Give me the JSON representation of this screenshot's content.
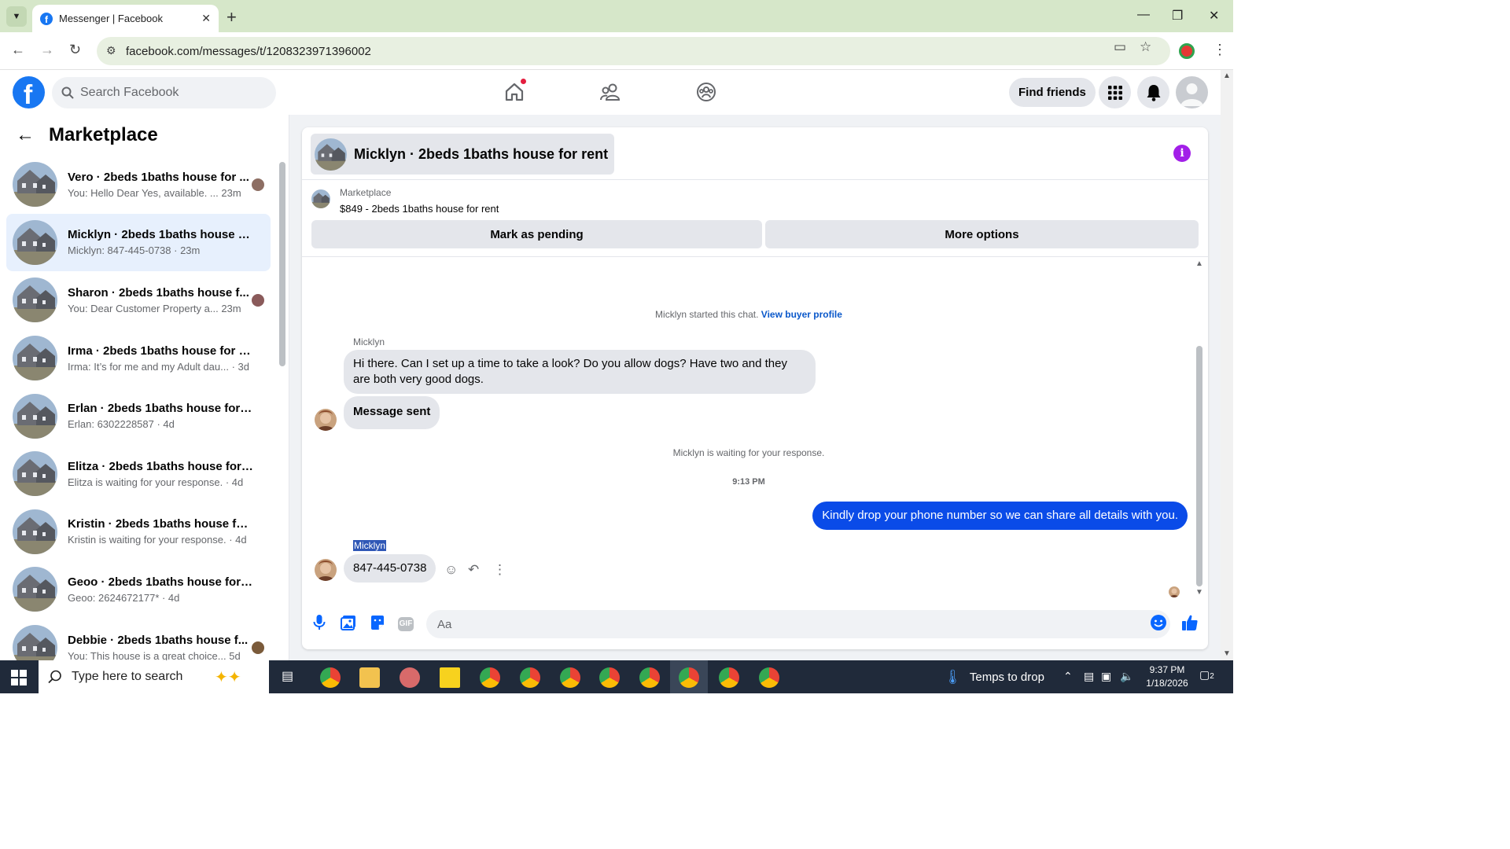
{
  "browser": {
    "tab_title": "Messenger | Facebook",
    "url": "facebook.com/messages/t/1208323971396002"
  },
  "fb_header": {
    "logo": "f",
    "search_placeholder": "Search Facebook",
    "find_friends_label": "Find friends"
  },
  "left_panel": {
    "title": "Marketplace",
    "conversations": [
      {
        "name": "Vero · 2beds 1baths house for ...",
        "preview": "You: Hello Dear Yes, available. ...  23m",
        "has_seen_avatar": true
      },
      {
        "name": "Micklyn · 2beds 1baths house fo...",
        "preview": "Micklyn: 847-445-0738 · 23m",
        "active": true
      },
      {
        "name": "Sharon · 2beds 1baths house f...",
        "preview": "You: Dear Customer Property a...  23m",
        "has_seen_avatar": true
      },
      {
        "name": "Irma · 2beds 1baths house for rent",
        "preview": "Irma: It’s for me and my Adult dau...  · 3d"
      },
      {
        "name": "Erlan · 2beds 1baths house for re...",
        "preview": "Erlan: 6302228587 · 4d"
      },
      {
        "name": "Elitza · 2beds 1baths house for r...",
        "preview": "Elitza is waiting for your response. · 4d"
      },
      {
        "name": "Kristin · 2beds 1baths house for ...",
        "preview": "Kristin is waiting for your response. · 4d"
      },
      {
        "name": "Geoo · 2beds 1baths house for r...",
        "preview": "Geoo: 2624672177* · 4d"
      },
      {
        "name": "Debbie · 2beds 1baths house f...",
        "preview": "You: This house is a great choice...  5d",
        "has_seen_avatar": true
      }
    ]
  },
  "chat": {
    "title": "Micklyn · 2beds 1baths house for rent",
    "listing_source": "Marketplace",
    "listing_text": "$849 - 2beds 1baths house for rent",
    "mark_pending_label": "Mark as pending",
    "more_options_label": "More options",
    "started_text": "Micklyn started this chat.",
    "view_buyer_profile": "View buyer profile",
    "messages": [
      {
        "sender": "Micklyn",
        "text": "Hi there. Can I set up a time to take a look? Do you allow dogs? Have two and they are both very good dogs."
      },
      {
        "text": "Message sent"
      }
    ],
    "waiting_text": "Micklyn is waiting for your response.",
    "timestamp": "9:13 PM",
    "my_message": "Kindly drop your phone number so we can share all details with you.",
    "reply_sender": "Micklyn",
    "reply_text": "847-445-0738",
    "composer_placeholder": "Aa"
  },
  "taskbar": {
    "search_placeholder": "Type here to search",
    "weather": "Temps to drop",
    "time": "9:37 PM",
    "date": "1/18/2026",
    "notification_count": "2"
  },
  "colors": {
    "fb_blue": "#1877f2",
    "my_bubble": "#0a4be8",
    "active_conv": "#e7f0fd",
    "info_purple": "#a21fe8",
    "tab_strip": "#d6e7c9"
  }
}
